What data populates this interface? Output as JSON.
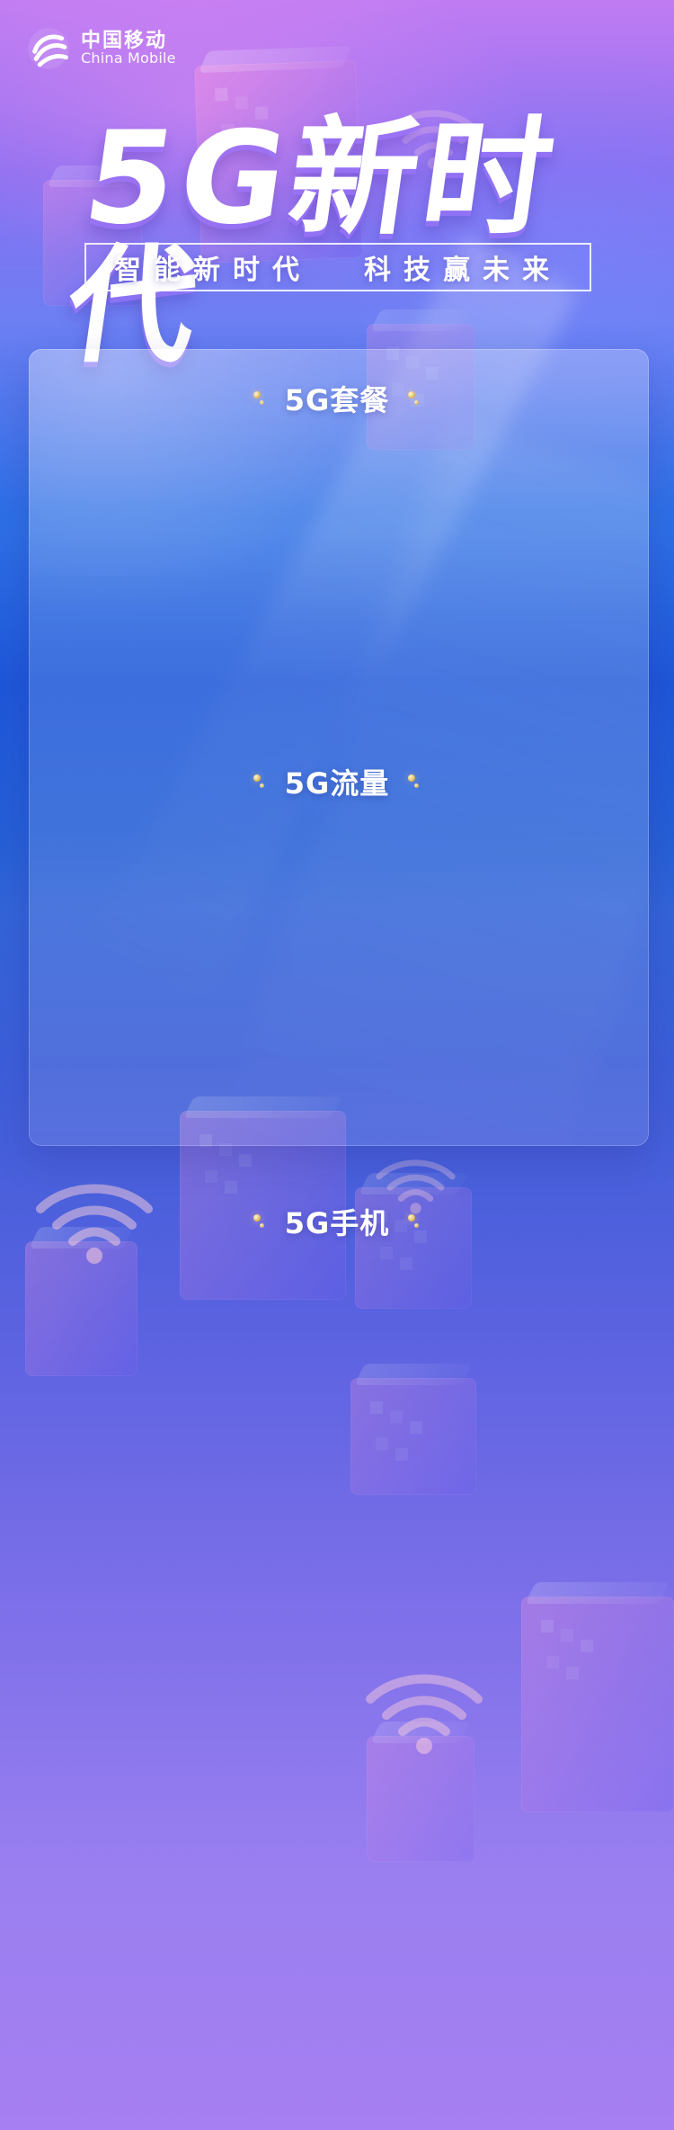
{
  "brand": {
    "logo_cn": "中国移动",
    "logo_en": "China Mobile",
    "logo_icon": "china-mobile-logo-icon"
  },
  "hero": {
    "title": "5G新时代",
    "subtitle_left": "智能新时代",
    "subtitle_right": "科技赢未来"
  },
  "sections": [
    {
      "title": "5G套餐",
      "ornament_left_icon": "gold-dot-ornament-icon",
      "ornament_right_icon": "gold-dot-ornament-icon"
    },
    {
      "title": "5G流量",
      "ornament_left_icon": "gold-dot-ornament-icon",
      "ornament_right_icon": "gold-dot-ornament-icon"
    },
    {
      "title": "5G手机",
      "ornament_left_icon": "gold-dot-ornament-icon",
      "ornament_right_icon": "gold-dot-ornament-icon"
    }
  ],
  "colors": {
    "primary_white": "#ffffff",
    "accent_gold": "#e5c167"
  }
}
